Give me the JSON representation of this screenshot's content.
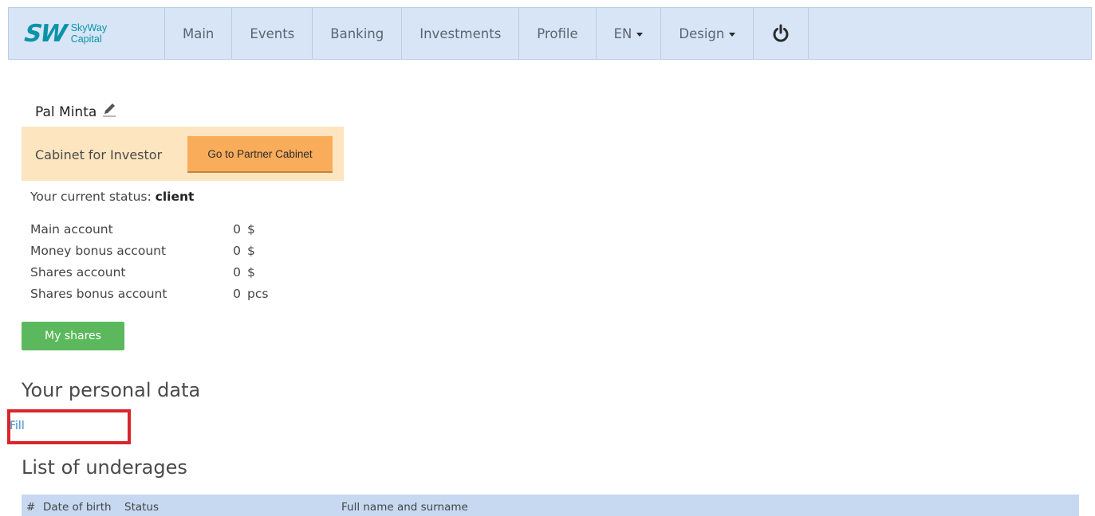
{
  "brand": {
    "logo_mark": "SW",
    "line1": "SkyWay",
    "line2": "Capital",
    "color": "#0b93a8"
  },
  "nav": {
    "items": [
      {
        "label": "Main"
      },
      {
        "label": "Events"
      },
      {
        "label": "Banking"
      },
      {
        "label": "Investments"
      },
      {
        "label": "Profile"
      }
    ],
    "language": "EN",
    "design": "Design",
    "power_icon": "power-icon"
  },
  "user": {
    "name": "Pal Minta",
    "edit_icon": "pencil-icon"
  },
  "cabinet": {
    "label": "Cabinet for Investor",
    "partner_button": "Go to Partner Cabinet"
  },
  "status": {
    "prefix": "Your current status:",
    "value": "client"
  },
  "accounts": [
    {
      "label": "Main account",
      "value": "0",
      "unit": "$"
    },
    {
      "label": "Money bonus account",
      "value": "0",
      "unit": "$"
    },
    {
      "label": "Shares account",
      "value": "0",
      "unit": "$"
    },
    {
      "label": "Shares bonus account",
      "value": "0",
      "unit": "pcs"
    }
  ],
  "my_shares_button": "My shares",
  "personal": {
    "heading": "Your personal data",
    "fill_link": "Fill"
  },
  "underages": {
    "heading": "List of underages",
    "columns": [
      "#",
      "Date of birth",
      "Status",
      "Full name and surname"
    ]
  },
  "colors": {
    "navbar": "#d7e5f6",
    "cabinet_bg": "#fce5bf",
    "partner_btn": "#f9ac5a",
    "green_btn": "#5cb85c",
    "highlight": "#d9262c",
    "table_header": "#c7d9f1"
  }
}
